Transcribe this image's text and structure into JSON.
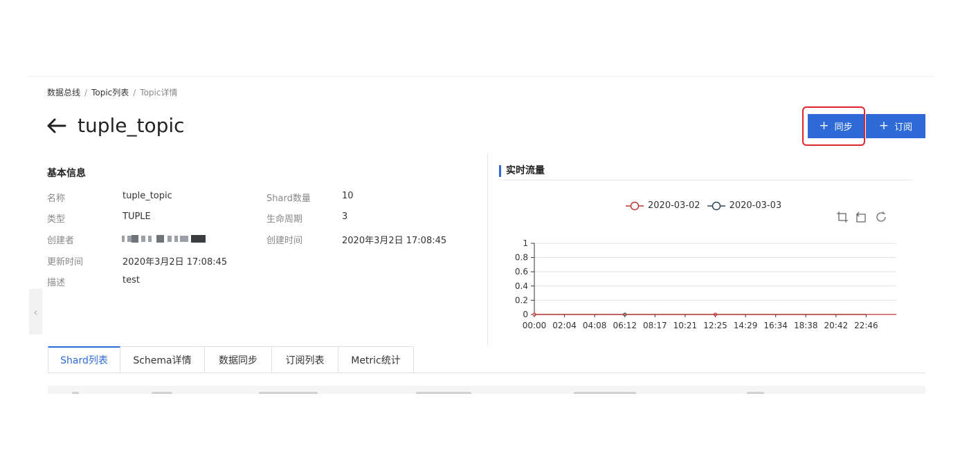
{
  "breadcrumb": {
    "items": [
      "数据总线",
      "Topic列表",
      "Topic详情"
    ],
    "separator": "/"
  },
  "header": {
    "title": "tuple_topic",
    "back_icon": "arrow-left-icon"
  },
  "actions": {
    "sync_label": "同步",
    "subscribe_label": "订阅",
    "plus_icon": "+",
    "accent_color": "#2f6bd6",
    "highlight_color": "#e0252f"
  },
  "basic_info": {
    "title": "基本信息",
    "fields": {
      "name": {
        "label": "名称",
        "value": "tuple_topic"
      },
      "type": {
        "label": "类型",
        "value": "TUPLE"
      },
      "creator": {
        "label": "创建者",
        "value": ""
      },
      "updated": {
        "label": "更新时间",
        "value": "2020年3月2日 17:08:45"
      },
      "description": {
        "label": "描述",
        "value": "test"
      },
      "shards": {
        "label": "Shard数量",
        "value": "10"
      },
      "lifecycle": {
        "label": "生命周期",
        "value": "3"
      },
      "created": {
        "label": "创建时间",
        "value": "2020年3月2日 17:08:45"
      }
    }
  },
  "realtime": {
    "title": "实时流量",
    "toolbox_icons": [
      "zoom-icon",
      "zoom-reset-icon",
      "restore-icon"
    ]
  },
  "chart_data": {
    "type": "line",
    "x": [
      "00:00",
      "02:04",
      "04:08",
      "06:12",
      "08:17",
      "10:21",
      "12:25",
      "14:29",
      "16:34",
      "18:38",
      "20:42",
      "22:46"
    ],
    "yticks": [
      "0",
      "0.2",
      "0.4",
      "0.6",
      "0.8",
      "1"
    ],
    "ylim": [
      0,
      1
    ],
    "series": [
      {
        "name": "2020-03-02",
        "color": "#c23531",
        "values": [
          0,
          0,
          0,
          0,
          0,
          0,
          0,
          0,
          0,
          0,
          0,
          0
        ],
        "markers_at": [
          0,
          6
        ]
      },
      {
        "name": "2020-03-03",
        "color": "#2f4554",
        "values": [
          0,
          0,
          0,
          0,
          0,
          0,
          0,
          0,
          0,
          0,
          0,
          0
        ],
        "markers_at": [
          3
        ]
      }
    ],
    "legend": "top-center",
    "grid": true
  },
  "tabs": [
    {
      "label": "Shard列表",
      "active": true
    },
    {
      "label": "Schema详情",
      "active": false
    },
    {
      "label": "数据同步",
      "active": false
    },
    {
      "label": "订阅列表",
      "active": false
    },
    {
      "label": "Metric统计",
      "active": false
    }
  ]
}
